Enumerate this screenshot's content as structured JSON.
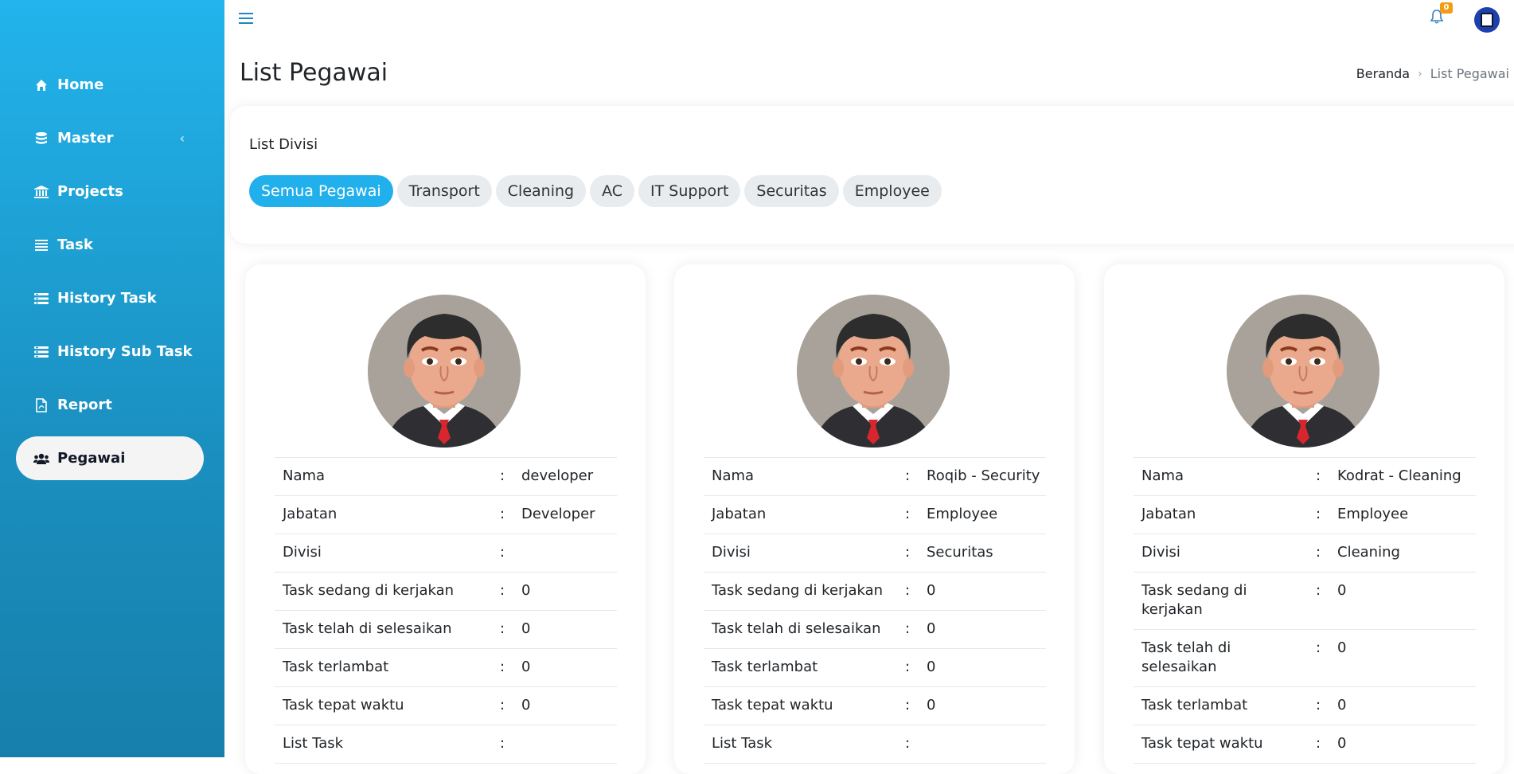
{
  "sidebar": {
    "items": [
      {
        "label": "Home",
        "icon": "home-icon"
      },
      {
        "label": "Master",
        "icon": "database-icon"
      },
      {
        "label": "Projects",
        "icon": "bank-icon"
      },
      {
        "label": "Task",
        "icon": "list-icon"
      },
      {
        "label": "History Task",
        "icon": "history-list-icon"
      },
      {
        "label": "History Sub Task",
        "icon": "history-list-icon"
      },
      {
        "label": "Report",
        "icon": "pdf-file-icon"
      },
      {
        "label": "Pegawai",
        "icon": "users-icon"
      }
    ],
    "active": "Pegawai"
  },
  "topbar": {
    "notification_count": "0"
  },
  "header": {
    "title": "List Pegawai",
    "breadcrumb": [
      "Beranda",
      "List Pegawai"
    ]
  },
  "divisi": {
    "title": "List Divisi",
    "tabs": [
      "Semua Pegawai",
      "Transport",
      "Cleaning",
      "AC",
      "IT Support",
      "Securitas",
      "Employee"
    ],
    "active_tab": "Semua Pegawai"
  },
  "employees": [
    {
      "rows": [
        {
          "label": "Nama",
          "value": "developer"
        },
        {
          "label": "Jabatan",
          "value": "Developer"
        },
        {
          "label": "Divisi",
          "value": ""
        },
        {
          "label": "Task sedang di kerjakan",
          "value": "0"
        },
        {
          "label": "Task telah di selesaikan",
          "value": "0"
        },
        {
          "label": "Task terlambat",
          "value": "0"
        },
        {
          "label": "Task tepat waktu",
          "value": "0"
        },
        {
          "label": "List Task",
          "value": ""
        }
      ]
    },
    {
      "rows": [
        {
          "label": "Nama",
          "value": "Roqib - Security"
        },
        {
          "label": "Jabatan",
          "value": "Employee"
        },
        {
          "label": "Divisi",
          "value": "Securitas"
        },
        {
          "label": "Task sedang di kerjakan",
          "value": "0"
        },
        {
          "label": "Task telah di selesaikan",
          "value": "0"
        },
        {
          "label": "Task terlambat",
          "value": "0"
        },
        {
          "label": "Task tepat waktu",
          "value": "0"
        },
        {
          "label": "List Task",
          "value": ""
        }
      ]
    },
    {
      "rows": [
        {
          "label": "Nama",
          "value": "Kodrat - Cleaning"
        },
        {
          "label": "Jabatan",
          "value": "Employee"
        },
        {
          "label": "Divisi",
          "value": "Cleaning"
        },
        {
          "label": "Task sedang di kerjakan",
          "value": "0"
        },
        {
          "label": "Task telah di selesaikan",
          "value": "0"
        },
        {
          "label": "Task terlambat",
          "value": "0"
        },
        {
          "label": "Task tepat waktu",
          "value": "0"
        }
      ]
    }
  ],
  "row_separator": ":",
  "colors": {
    "sidebar_top": "#22b4ec",
    "sidebar_bottom": "#177fab",
    "accent": "#21b0ec",
    "badge": "#f39c12"
  }
}
